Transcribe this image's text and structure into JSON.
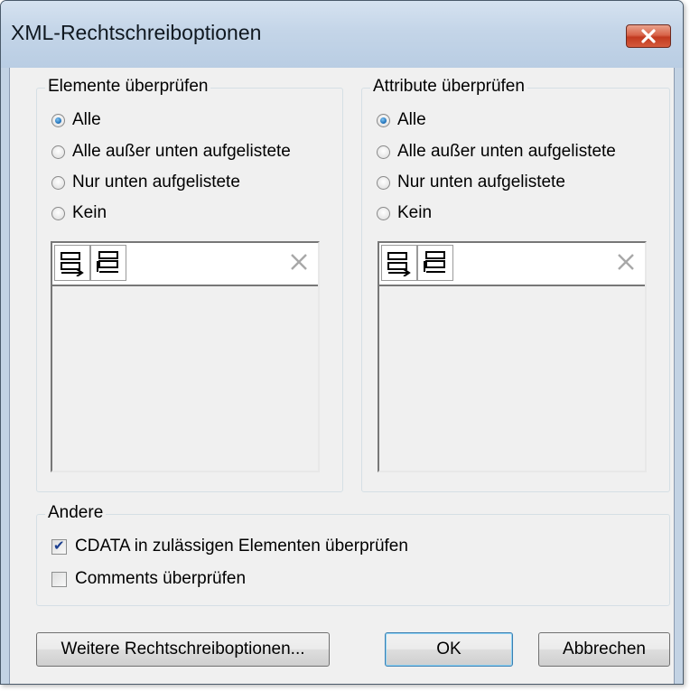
{
  "window": {
    "title": "XML-Rechtschreiboptionen"
  },
  "elements_group": {
    "legend": "Elemente überprüfen",
    "options": [
      {
        "label": "Alle",
        "checked": true
      },
      {
        "label": "Alle außer unten aufgelistete",
        "checked": false
      },
      {
        "label": "Nur unten aufgelistete",
        "checked": false
      },
      {
        "label": "Kein",
        "checked": false
      }
    ]
  },
  "attributes_group": {
    "legend": "Attribute überprüfen",
    "options": [
      {
        "label": "Alle",
        "checked": true
      },
      {
        "label": "Alle außer unten aufgelistete",
        "checked": false
      },
      {
        "label": "Nur unten aufgelistete",
        "checked": false
      },
      {
        "label": "Kein",
        "checked": false
      }
    ]
  },
  "other_group": {
    "legend": "Andere",
    "cdata_label": "CDATA in zulässigen Elementen überprüfen",
    "cdata_checked": true,
    "comments_label": "Comments überprüfen",
    "comments_checked": false
  },
  "buttons": {
    "more_options": "Weitere Rechtschreiboptionen...",
    "ok": "OK",
    "cancel": "Abbrechen"
  },
  "icons": {
    "close": "close-icon",
    "insert": "insert-row-icon",
    "append": "append-row-icon",
    "delete": "delete-icon"
  },
  "colors": {
    "close_button": "#c8452b",
    "radio_selected": "#1a6bb5",
    "checkbox_check": "#1b3f8f",
    "default_button_border": "#3c7fb1"
  }
}
